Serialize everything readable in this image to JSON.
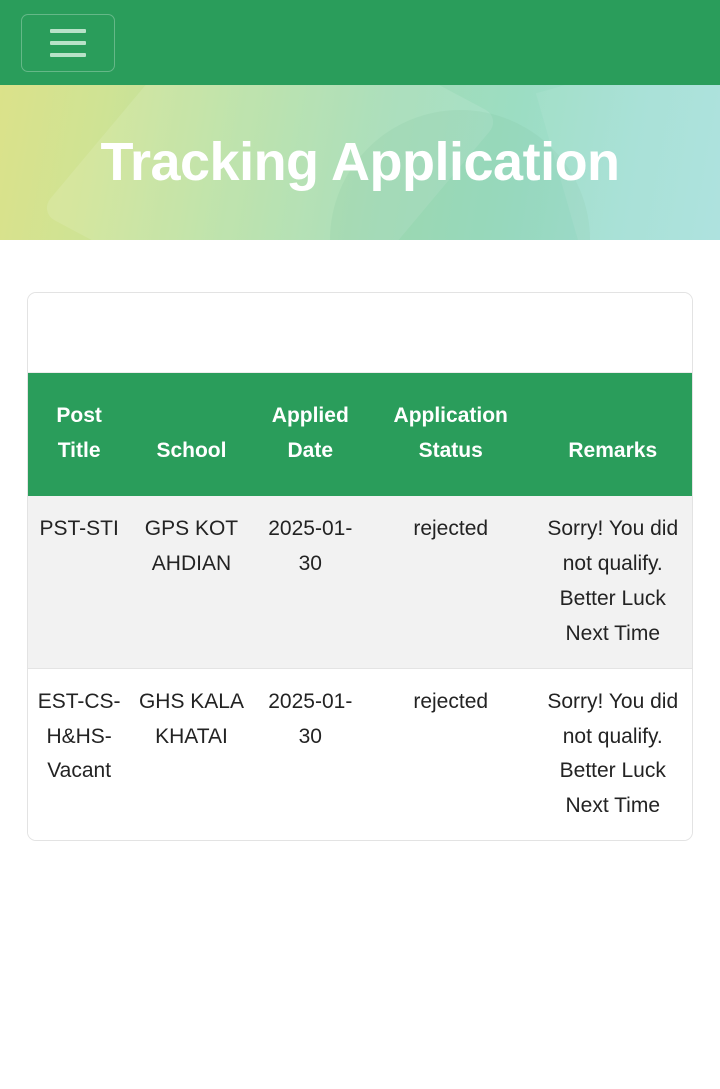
{
  "navbar": {
    "toggler_icon": "hamburger-menu-icon",
    "bg_color": "#2a9d5b"
  },
  "hero": {
    "title": "Tracking Application",
    "gradient_from": "#dbe28a",
    "gradient_to": "#a8e0dd",
    "title_color": "#ffffff"
  },
  "table": {
    "headers": [
      "Post Title",
      "School",
      "Applied Date",
      "Application Status",
      "Remarks"
    ],
    "header_bg": "#2a9d5b",
    "rows": [
      {
        "post_title": "PST-STI",
        "school": "GPS KOT AHDIAN",
        "applied_date": "2025-01-30",
        "application_status": "rejected",
        "remarks": "Sorry! You did not qualify. Better Luck Next Time"
      },
      {
        "post_title": "EST-CS-H&HS-Vacant",
        "school": "GHS KALA KHATAI",
        "applied_date": "2025-01-30",
        "application_status": "rejected",
        "remarks": "Sorry! You did not qualify. Better Luck Next Time"
      }
    ]
  }
}
